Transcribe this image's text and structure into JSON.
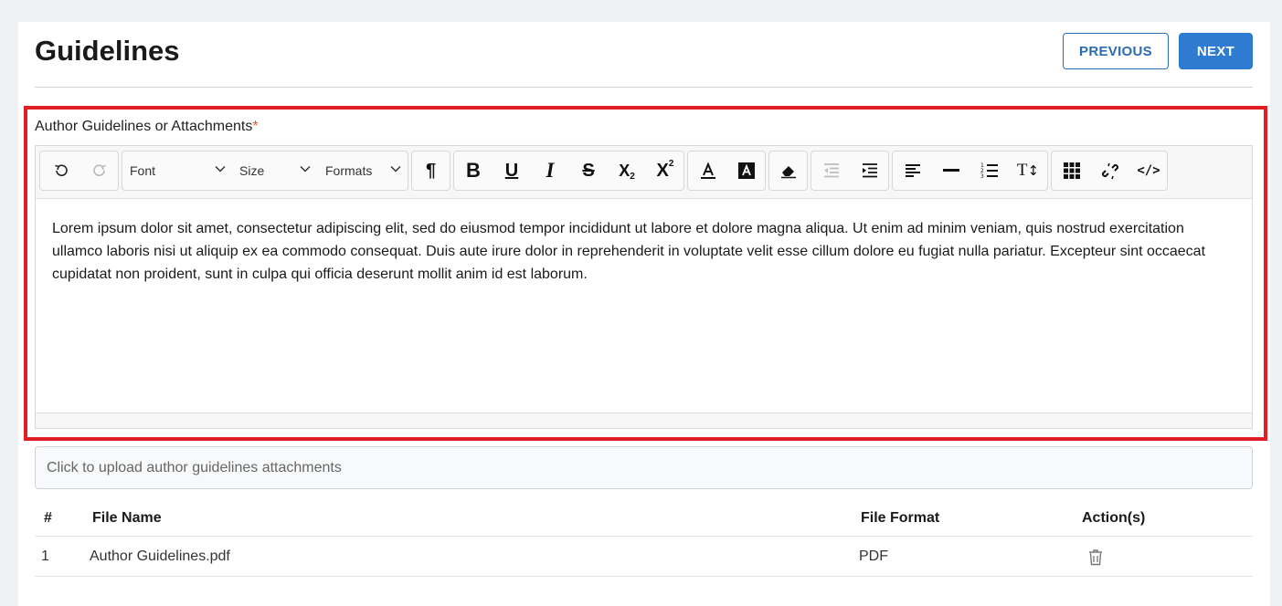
{
  "header": {
    "title": "Guidelines",
    "previous_label": "PREVIOUS",
    "next_label": "NEXT"
  },
  "editor_field": {
    "label": "Author Guidelines or Attachments",
    "required_mark": "*",
    "content": "Lorem ipsum dolor sit amet, consectetur adipiscing elit, sed do eiusmod tempor incididunt ut labore et dolore magna aliqua. Ut enim ad minim veniam, quis nostrud exercitation ullamco laboris nisi ut aliquip ex ea commodo consequat. Duis aute irure dolor in reprehenderit in voluptate velit esse cillum dolore eu fugiat nulla pariatur. Excepteur sint occaecat cupidatat non proident, sunt in culpa qui officia deserunt mollit anim id est laborum."
  },
  "toolbar": {
    "font_select": "Font",
    "size_select": "Size",
    "formats_select": "Formats",
    "icons": [
      "undo-icon",
      "redo-icon",
      "paragraph-icon",
      "bold-icon",
      "underline-icon",
      "italic-icon",
      "strikethrough-icon",
      "subscript-icon",
      "superscript-icon",
      "font-color-icon",
      "highlight-color-icon",
      "eraser-icon",
      "outdent-icon",
      "indent-icon",
      "align-left-icon",
      "horizontal-rule-icon",
      "ordered-list-icon",
      "line-height-icon",
      "table-icon",
      "link-icon",
      "code-view-icon"
    ]
  },
  "upload": {
    "placeholder": "Click to upload author guidelines attachments"
  },
  "table": {
    "columns": [
      "#",
      "File Name",
      "File Format",
      "Action(s)"
    ],
    "rows": [
      {
        "index": "1",
        "file_name": "Author Guidelines.pdf",
        "file_format": "PDF"
      }
    ]
  },
  "colors": {
    "accent": "#2e7bd1",
    "highlight_border": "#e01e24",
    "required": "#e05a2b"
  }
}
